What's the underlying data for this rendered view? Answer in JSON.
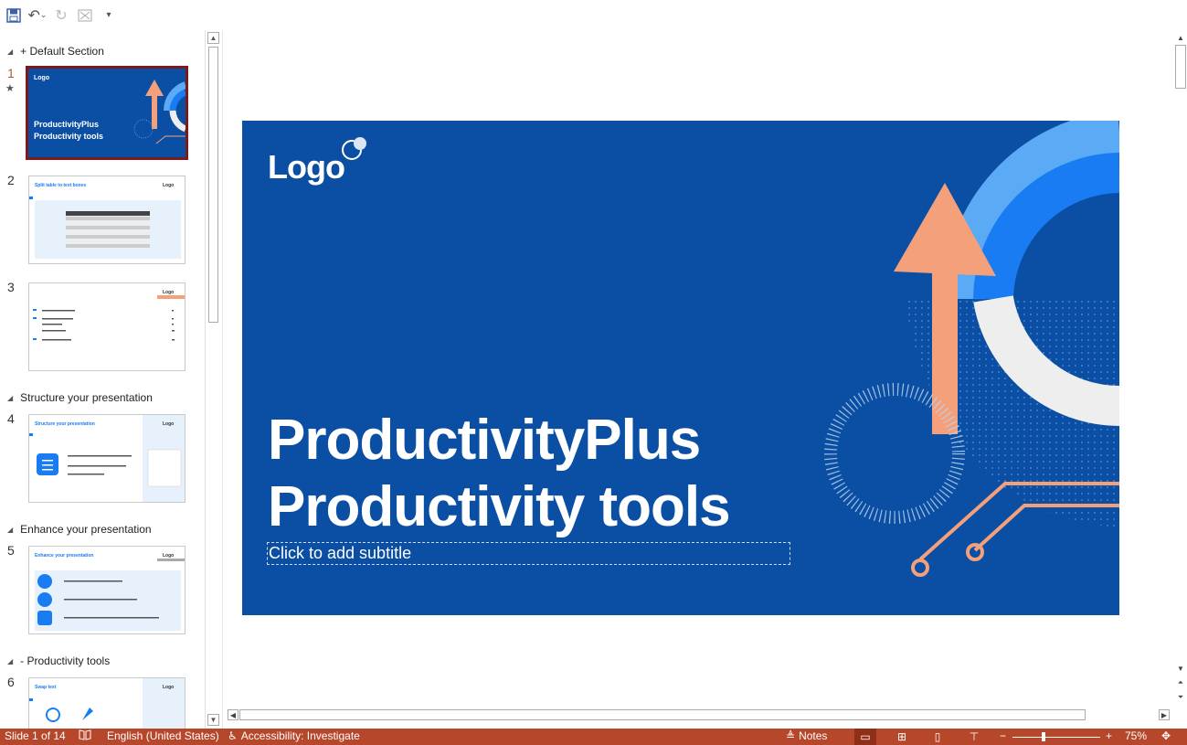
{
  "sections": [
    {
      "label": "Default Section",
      "prefix": "+"
    },
    {
      "label": "Structure your presentation",
      "prefix": ""
    },
    {
      "label": "Enhance your presentation",
      "prefix": ""
    },
    {
      "label": "Productivity tools",
      "prefix": "-"
    }
  ],
  "slides": [
    {
      "num": "1",
      "title": "ProductivityPlus Productivity tools",
      "logo": "Logo"
    },
    {
      "num": "2",
      "title": "Split table to text boxes",
      "logo": "Logo"
    },
    {
      "num": "3",
      "title": "",
      "logo": "Logo"
    },
    {
      "num": "4",
      "title": "Structure your presentation",
      "logo": "Logo"
    },
    {
      "num": "5",
      "title": "Enhance your presentation",
      "logo": "Logo"
    },
    {
      "num": "6",
      "title": "Swap text",
      "logo": "Logo"
    }
  ],
  "main_slide": {
    "logo": "Logo",
    "title_line1": "ProductivityPlus",
    "title_line2": "Productivity tools",
    "subtitle_placeholder": "Click to add subtitle"
  },
  "status": {
    "slide_info": "Slide 1 of 14",
    "language": "English (United States)",
    "accessibility": "Accessibility: Investigate",
    "notes": "Notes",
    "zoom": "75%"
  },
  "colors": {
    "slide_bg": "#0a4fa3",
    "accent_orange": "#f4a07a",
    "accent_blue": "#1a7cf2",
    "light_blue": "#5aaaf5",
    "status_bar": "#b7472a"
  }
}
